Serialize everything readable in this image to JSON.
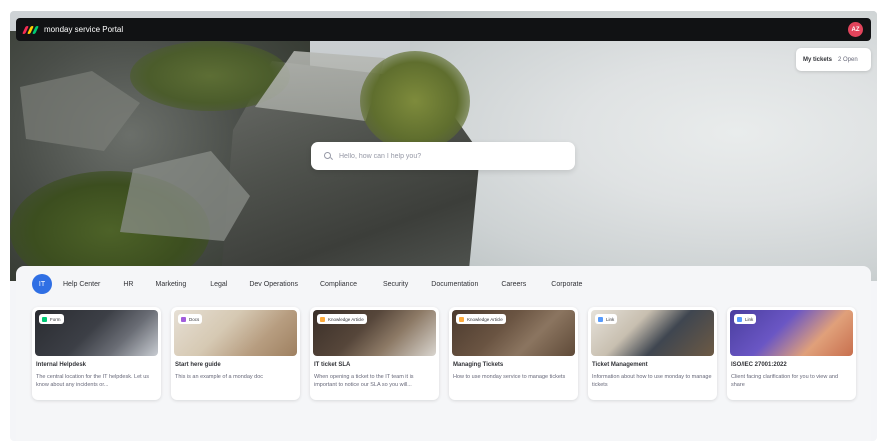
{
  "topbar": {
    "brand": "monday service Portal",
    "avatar_initials": "AZ"
  },
  "logo_colors": [
    "#f62b54",
    "#ffcb00",
    "#00ca72"
  ],
  "my_tickets": {
    "label": "My tickets",
    "count": "2 Open"
  },
  "search": {
    "placeholder": "Hello, how can I help you?",
    "value": ""
  },
  "tabs": [
    {
      "label": "IT",
      "active": true
    },
    {
      "label": "Help Center"
    },
    {
      "label": "HR"
    },
    {
      "label": "Marketing"
    },
    {
      "label": "Legal"
    },
    {
      "label": "Dev Operations"
    },
    {
      "label": "Compliance"
    },
    {
      "label": "Security"
    },
    {
      "label": "Documentation"
    },
    {
      "label": "Careers"
    },
    {
      "label": "Corporate"
    }
  ],
  "cards": [
    {
      "badge": "Form",
      "badge_color": "#00c875",
      "title": "Internal Helpdesk",
      "desc": "The central location for the IT helpdesk. Let us know about any incidents or..."
    },
    {
      "badge": "Docs",
      "badge_color": "#a25ddc",
      "title": "Start here guide",
      "desc": "This is an example of a monday doc"
    },
    {
      "badge": "Knowledge Article",
      "badge_color": "#fdab3d",
      "title": "IT ticket SLA",
      "desc": "When opening a ticket to the IT team it is important to notice our SLA so you will..."
    },
    {
      "badge": "Knowledge Article",
      "badge_color": "#fdab3d",
      "title": "Managing Tickets",
      "desc": "How to use monday service to manage tickets"
    },
    {
      "badge": "Link",
      "badge_color": "#579bfc",
      "title": "Ticket Management",
      "desc": "Information about how to use monday to manage tickets"
    },
    {
      "badge": "Link",
      "badge_color": "#579bfc",
      "title": "ISO/IEC 27001:2022",
      "desc": "Client facing clarification for you to view and share"
    }
  ]
}
